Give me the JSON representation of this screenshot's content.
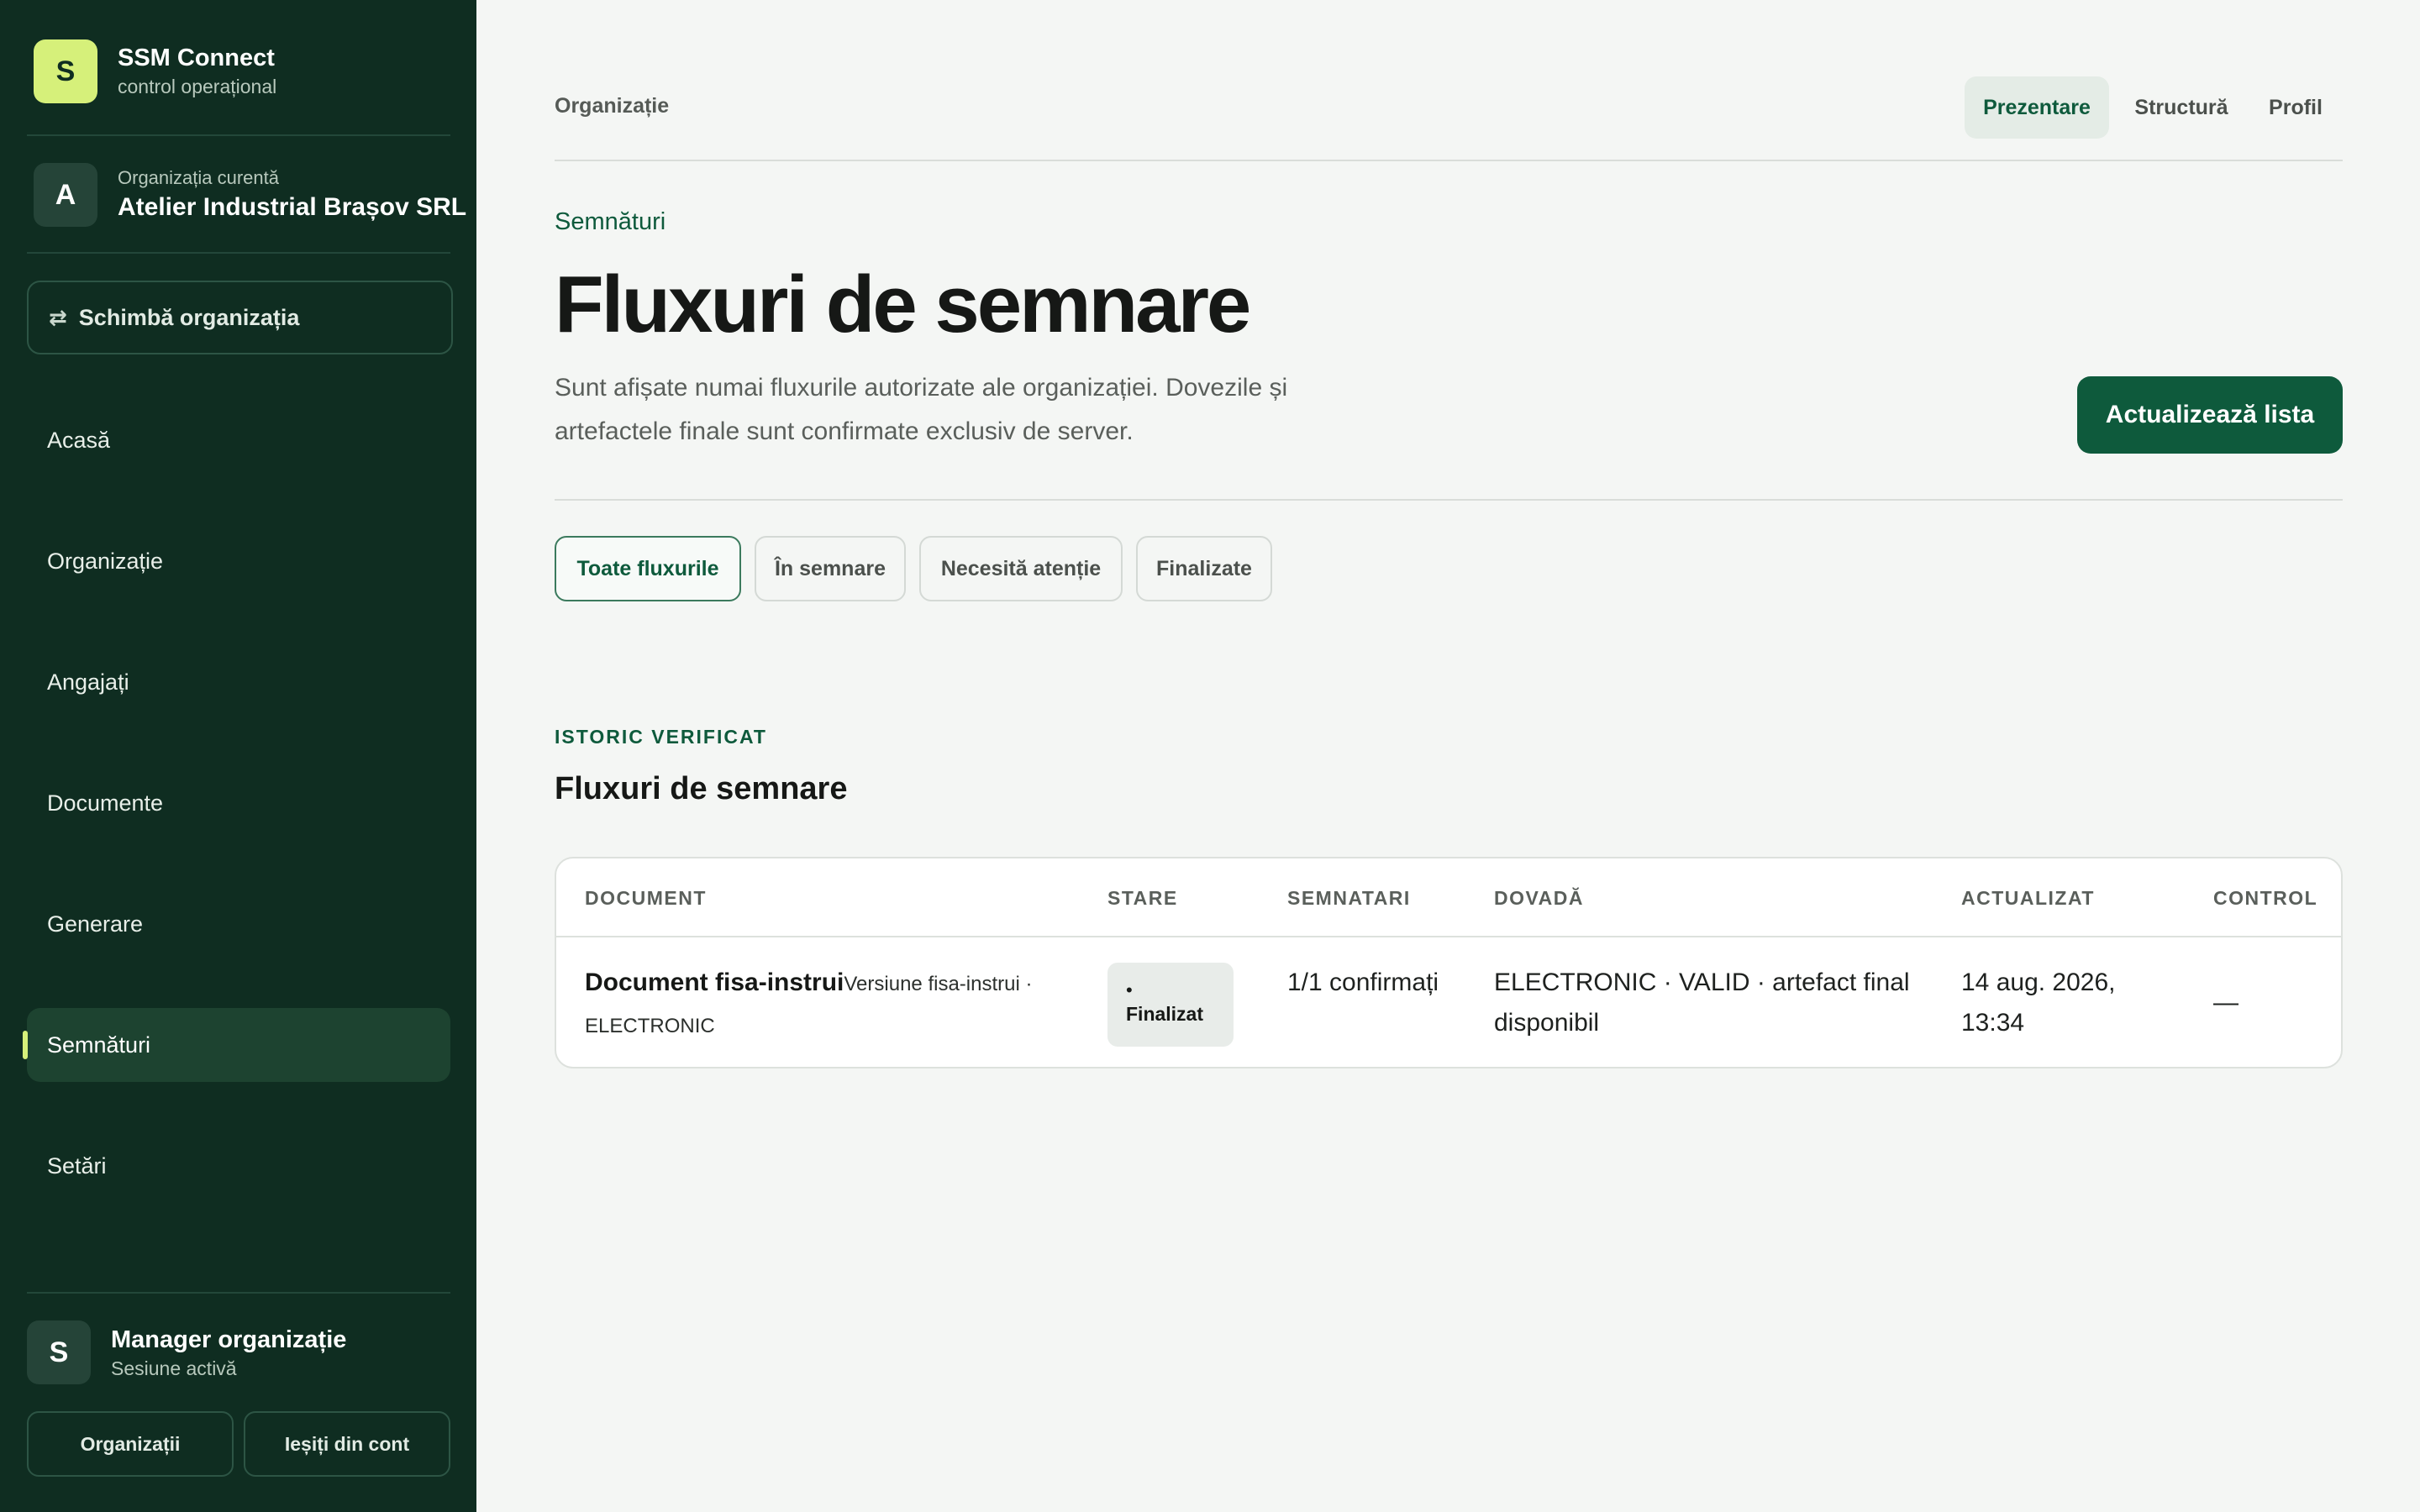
{
  "sidebar": {
    "brand": {
      "logo_letter": "S",
      "name": "SSM Connect",
      "subtitle": "control operațional"
    },
    "org": {
      "avatar_letter": "A",
      "caption": "Organizația curentă",
      "name": "Atelier Industrial Brașov SRL"
    },
    "switch": {
      "icon": "⇄",
      "label": "Schimbă organizația"
    },
    "nav": [
      {
        "label": "Acasă"
      },
      {
        "label": "Organizație"
      },
      {
        "label": "Angajați"
      },
      {
        "label": "Documente"
      },
      {
        "label": "Generare"
      },
      {
        "label": "Semnături",
        "active": true
      },
      {
        "label": "Setări"
      }
    ],
    "user": {
      "avatar_letter": "S",
      "role": "Manager organizație",
      "status": "Sesiune activă"
    },
    "buttons": {
      "organizations": "Organizații",
      "logout": "Ieșiți din cont"
    },
    "accent_color": "#d6f07a",
    "background_color": "#0f2d21"
  },
  "topbar": {
    "label": "Organizație",
    "tabs": [
      {
        "label": "Prezentare",
        "active": true
      },
      {
        "label": "Structură"
      },
      {
        "label": "Profil"
      }
    ]
  },
  "header": {
    "eyebrow": "Semnături",
    "title": "Fluxuri de semnare",
    "description": "Sunt afișate numai fluxurile autorizate ale organizației. Dovezile și artefactele finale sunt confirmate exclusiv de server.",
    "refresh_button": "Actualizează lista"
  },
  "filters": [
    {
      "label": "Toate fluxurile",
      "active": true
    },
    {
      "label": "În semnare"
    },
    {
      "label": "Necesită atenție"
    },
    {
      "label": "Finalizate"
    }
  ],
  "section": {
    "eyebrow": "ISTORIC VERIFICAT",
    "title": "Fluxuri de semnare"
  },
  "table": {
    "columns": [
      "DOCUMENT",
      "STARE",
      "SEMNATARI",
      "DOVADĂ",
      "ACTUALIZAT",
      "CONTROL"
    ],
    "rows": [
      {
        "document": "Document fisa-instrui",
        "meta": "Versiune fisa-instrui · ELECTRONIC",
        "status_dot": "•",
        "status": "Finalizat",
        "signers": "1/1 confirmați",
        "evidence": "ELECTRONIC · VALID · artefact final disponibil",
        "updated": "14 aug. 2026, 13:34",
        "control": "—"
      }
    ]
  },
  "colors": {
    "primary": "#0e5a3c",
    "page_background": "#f4f6f4"
  }
}
